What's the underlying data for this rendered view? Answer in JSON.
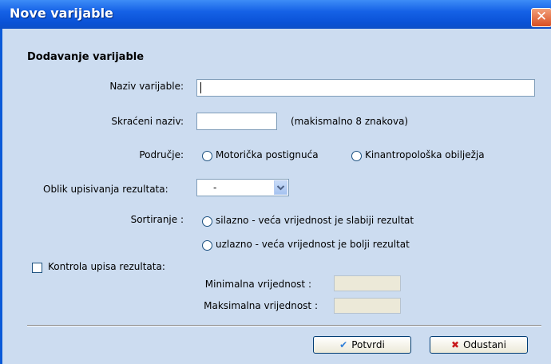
{
  "window": {
    "title": "Nove varijable",
    "close_glyph": "✕"
  },
  "section_title": "Dodavanje varijable",
  "fields": {
    "name_label": "Naziv varijable:",
    "name_value": "",
    "short_label": "Skraćeni naziv:",
    "short_value": "",
    "short_hint": "(makismalno 8 znakova)"
  },
  "area": {
    "label": "Područje:",
    "options": [
      "Motorička postignuća",
      "Kinantropološka obilježja"
    ]
  },
  "result_format": {
    "label": "Oblik upisivanja rezultata:",
    "selected": "-"
  },
  "sorting": {
    "label": "Sortiranje :",
    "options": [
      "silazno - veća vrijednost je slabiji rezultat",
      "uzlazno - veća vrijednost je bolji rezultat"
    ]
  },
  "control": {
    "checkbox_label": "Kontrola upisa rezultata:",
    "min_label": "Minimalna vrijednost :",
    "max_label": "Maksimalna vrijednost :",
    "min_value": "",
    "max_value": ""
  },
  "buttons": {
    "confirm": "Potvrdi",
    "cancel": "Odustani",
    "confirm_icon": "✔",
    "cancel_icon": "✖"
  },
  "colors": {
    "titlebar": "#0a52d6",
    "client_bg": "#ccdcf0",
    "close": "#d84e22",
    "confirm_icon": "#2f7fd8",
    "cancel_icon": "#c8171b"
  }
}
